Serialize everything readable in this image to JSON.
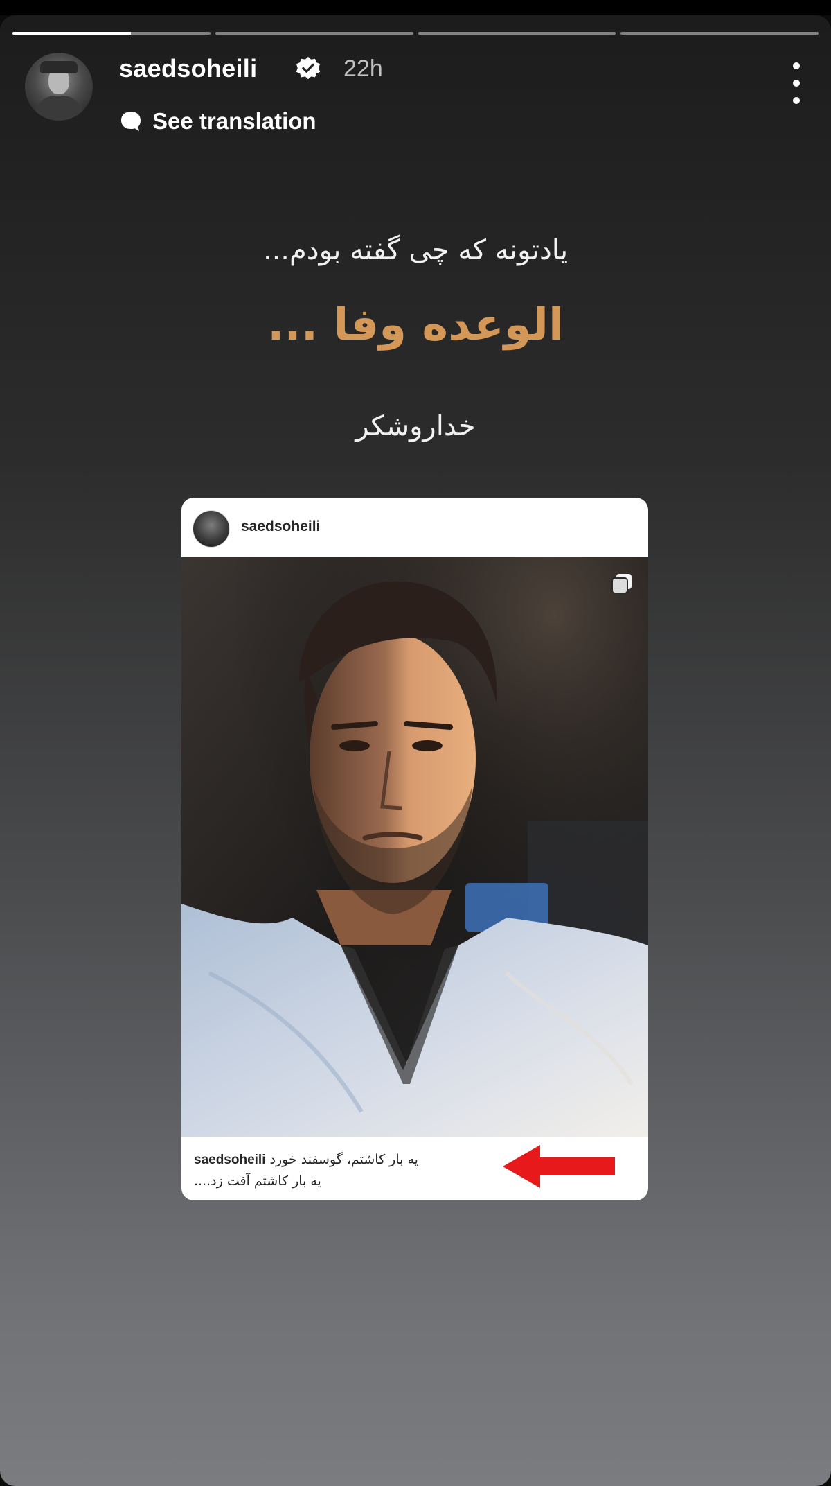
{
  "story": {
    "progress_segments": [
      1,
      0,
      0,
      0
    ],
    "username": "saedsoheili",
    "time": "22h",
    "translate_label": "See translation"
  },
  "text_overlay": {
    "line1": "یادتونه که چی گفته بودم...",
    "line2": "الوعده وفا ...",
    "line3": "خداروشکر"
  },
  "embedded_post": {
    "username": "saedsoheili",
    "caption_user": "saedsoheili",
    "caption_line1": "یه بار کاشتم، گوسفند خورد",
    "caption_line2": "یه بار کاشتم آفت زد...."
  },
  "colors": {
    "accent_text": "#d39758",
    "arrow": "#e8191b",
    "verified_badge": "#ffffff"
  },
  "icons": {
    "verified": "verified-badge-icon",
    "translate": "speech-bubble-icon",
    "more": "more-vertical-icon",
    "carousel": "carousel-icon",
    "arrow": "red-arrow-left"
  }
}
